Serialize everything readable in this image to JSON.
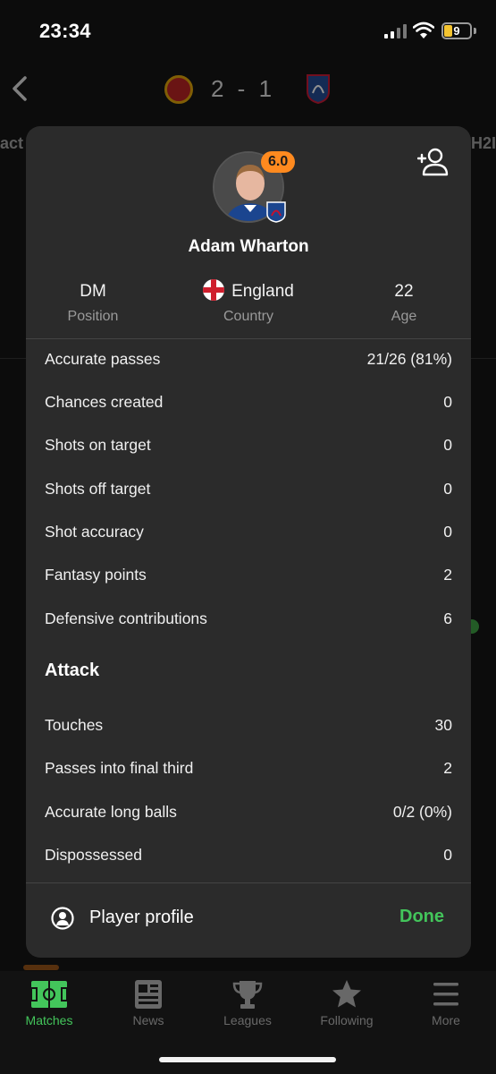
{
  "status_bar": {
    "time": "23:34",
    "battery": "9"
  },
  "match": {
    "score": "2 - 1",
    "tab_left": "act",
    "tab_right": "H2I"
  },
  "player": {
    "rating": "6.0",
    "name": "Adam Wharton",
    "position_value": "DM",
    "position_label": "Position",
    "country_value": "England",
    "country_label": "Country",
    "age_value": "22",
    "age_label": "Age"
  },
  "stats": [
    {
      "name": "Accurate passes",
      "value": "21/26 (81%)"
    },
    {
      "name": "Chances created",
      "value": "0"
    },
    {
      "name": "Shots on target",
      "value": "0"
    },
    {
      "name": "Shots off target",
      "value": "0"
    },
    {
      "name": "Shot accuracy",
      "value": "0"
    },
    {
      "name": "Fantasy points",
      "value": "2"
    },
    {
      "name": "Defensive contributions",
      "value": "6"
    }
  ],
  "attack": {
    "title": "Attack",
    "stats": [
      {
        "name": "Touches",
        "value": "30"
      },
      {
        "name": "Passes into final third",
        "value": "2"
      },
      {
        "name": "Accurate long balls",
        "value": "0/2 (0%)"
      },
      {
        "name": "Dispossessed",
        "value": "0"
      }
    ]
  },
  "footer": {
    "profile_label": "Player profile",
    "done_label": "Done"
  },
  "bottom_nav": {
    "items": [
      {
        "label": "Matches",
        "icon": "pitch-icon"
      },
      {
        "label": "News",
        "icon": "newspaper-icon"
      },
      {
        "label": "Leagues",
        "icon": "trophy-icon"
      },
      {
        "label": "Following",
        "icon": "star-icon"
      },
      {
        "label": "More",
        "icon": "menu-icon"
      }
    ]
  },
  "colors": {
    "accent": "#43c55b",
    "rating": "#ff8a1f",
    "modal_bg": "#2b2b2b"
  }
}
